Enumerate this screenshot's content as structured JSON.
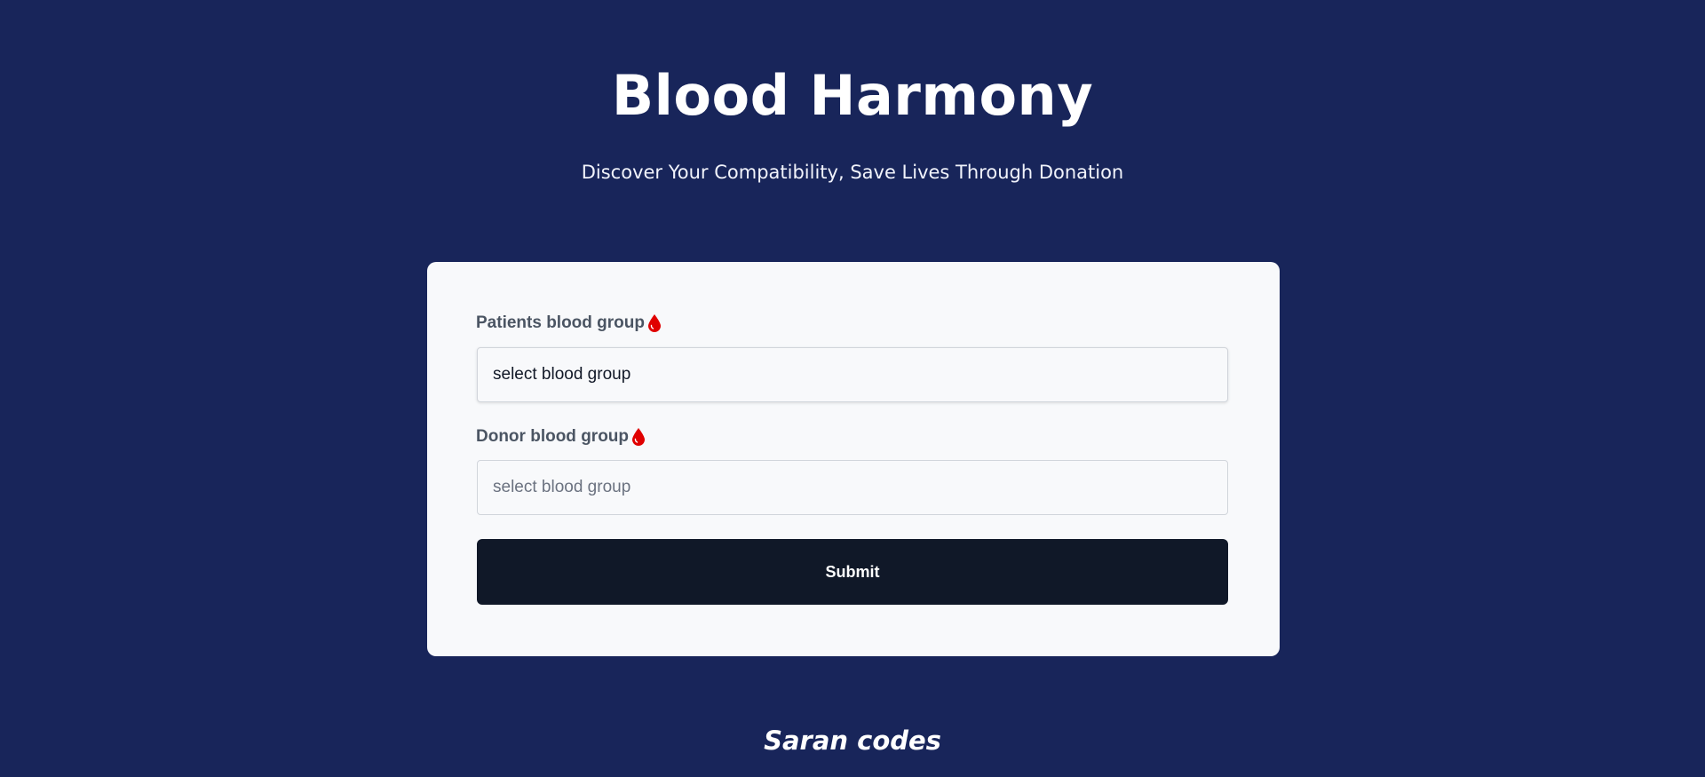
{
  "header": {
    "title": "Blood Harmony",
    "subtitle": "Discover Your Compatibility, Save Lives Through Donation"
  },
  "form": {
    "patient": {
      "label": "Patients blood group",
      "icon": "blood-drop-icon",
      "value": "select blood group"
    },
    "donor": {
      "label": "Donor blood group",
      "icon": "blood-drop-icon",
      "placeholder": "select blood group"
    },
    "submit_label": "Submit"
  },
  "footer": {
    "credit": "Saran codes"
  },
  "colors": {
    "background": "#18255a",
    "card": "#f8f9fb",
    "button": "#101828",
    "drop": "#e00000"
  }
}
